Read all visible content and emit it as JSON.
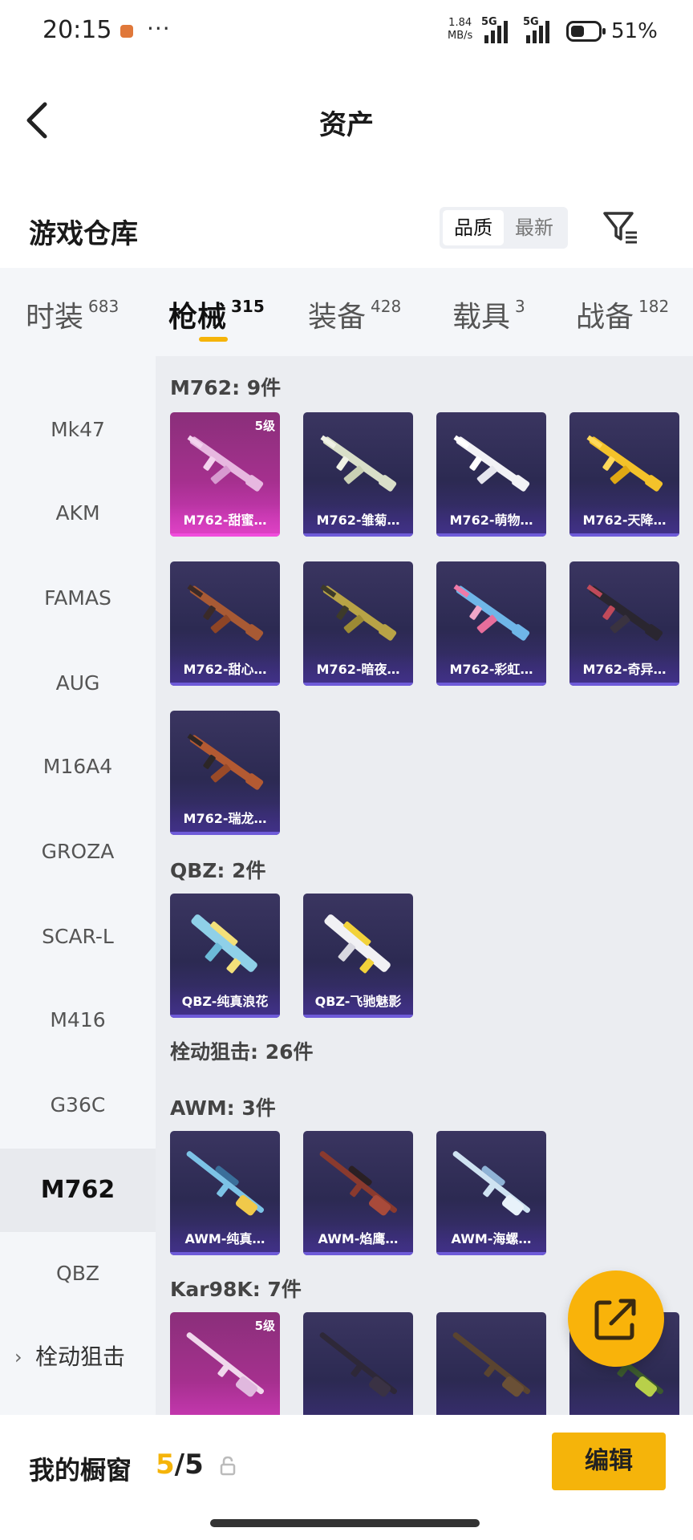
{
  "status_bar": {
    "time": "20:15",
    "speed_value": "1.84",
    "speed_unit": "MB/s",
    "signal1_label": "5G",
    "signal2_label": "5G",
    "battery_percent": "51%",
    "battery_level": 0.51
  },
  "header": {
    "title": "资产"
  },
  "warehouse": {
    "title": "游戏仓库",
    "sort_options": [
      "品质",
      "最新"
    ],
    "sort_selected": "品质"
  },
  "category_tabs": [
    {
      "label": "时装",
      "count": "683"
    },
    {
      "label": "枪械",
      "count": "315",
      "active": true
    },
    {
      "label": "装备",
      "count": "428"
    },
    {
      "label": "载具",
      "count": "3"
    },
    {
      "label": "战备",
      "count": "182"
    }
  ],
  "sidebar": {
    "items": [
      "Mk47",
      "AKM",
      "FAMAS",
      "AUG",
      "M16A4",
      "GROZA",
      "SCAR-L",
      "M416",
      "G36C",
      "M762",
      "QBZ"
    ],
    "active": "M762",
    "group_label": "栓动狙击"
  },
  "groups": [
    {
      "title": "M762: 9件",
      "items": [
        {
          "name": "M762-甜蜜…",
          "level": "5级",
          "rarity": "gold"
        },
        {
          "name": "M762-雏菊…",
          "rarity": "normal"
        },
        {
          "name": "M762-萌物…",
          "rarity": "normal"
        },
        {
          "name": "M762-天降…",
          "rarity": "normal"
        },
        {
          "name": "M762-甜心…",
          "rarity": "normal"
        },
        {
          "name": "M762-暗夜…",
          "rarity": "normal"
        },
        {
          "name": "M762-彩虹…",
          "rarity": "normal"
        },
        {
          "name": "M762-奇异…",
          "rarity": "normal"
        },
        {
          "name": "M762-瑞龙…",
          "rarity": "normal"
        }
      ]
    },
    {
      "title": "QBZ: 2件",
      "items": [
        {
          "name": "QBZ-纯真浪花",
          "rarity": "normal"
        },
        {
          "name": "QBZ-飞驰魅影",
          "rarity": "normal"
        }
      ]
    },
    {
      "title": "栓动狙击: 26件",
      "items": []
    },
    {
      "title": "AWM: 3件",
      "items": [
        {
          "name": "AWM-纯真…",
          "rarity": "normal"
        },
        {
          "name": "AWM-焰鹰…",
          "rarity": "normal"
        },
        {
          "name": "AWM-海螺…",
          "rarity": "normal"
        }
      ]
    },
    {
      "title": "Kar98K: 7件",
      "items": [
        {
          "name": "",
          "level": "5级",
          "rarity": "gold"
        },
        {
          "name": "",
          "rarity": "normal"
        },
        {
          "name": "",
          "rarity": "normal"
        },
        {
          "name": "",
          "rarity": "normal"
        }
      ]
    }
  ],
  "bottom_bar": {
    "label": "我的橱窗",
    "current": "5",
    "separator": "/",
    "total": "5",
    "edit_label": "编辑"
  },
  "colors": {
    "accent": "#f5b40a",
    "card_normal": "#2c2a52",
    "card_gold": "#a5308e"
  }
}
